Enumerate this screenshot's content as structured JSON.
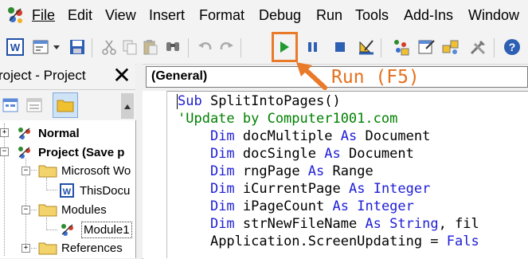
{
  "menu": {
    "items": [
      "File",
      "Edit",
      "View",
      "Insert",
      "Format",
      "Debug",
      "Run",
      "Tools",
      "Add-Ins",
      "Window"
    ]
  },
  "toolbar": {
    "buttons": [
      "word-icon",
      "insert-userform-icon",
      "dropdown-arrow-icon",
      "save-icon",
      "cut-icon",
      "copy-icon",
      "paste-icon",
      "find-icon",
      "undo-icon",
      "redo-icon",
      "run-icon",
      "break-icon",
      "reset-icon",
      "design-mode-icon",
      "project-explorer-icon",
      "properties-window-icon",
      "object-browser-icon",
      "toolbox-icon",
      "help-icon"
    ]
  },
  "project_pane": {
    "title": "roject - Project",
    "close_glyph": "✕",
    "tree": [
      {
        "label": "Normal",
        "bold": true
      },
      {
        "label": "Project (Save p",
        "bold": true
      },
      {
        "label": "Microsoft Wo",
        "bold": false
      },
      {
        "label": "ThisDocu",
        "bold": false
      },
      {
        "label": "Modules",
        "bold": false
      },
      {
        "label": "Module1",
        "bold": false
      },
      {
        "label": "References",
        "bold": false
      }
    ]
  },
  "code_pane": {
    "object_combo": "(General)",
    "lines": [
      {
        "indent": "",
        "parts": [
          {
            "t": "Sub",
            "c": "kw"
          },
          {
            "t": " SplitIntoPages()",
            "c": ""
          }
        ]
      },
      {
        "indent": "",
        "parts": [
          {
            "t": "'Update by Computer1001.com",
            "c": "cm"
          }
        ]
      },
      {
        "indent": "    ",
        "parts": [
          {
            "t": "Dim",
            "c": "kw"
          },
          {
            "t": " docMultiple ",
            "c": ""
          },
          {
            "t": "As",
            "c": "kw"
          },
          {
            "t": " Document",
            "c": ""
          }
        ]
      },
      {
        "indent": "    ",
        "parts": [
          {
            "t": "Dim",
            "c": "kw"
          },
          {
            "t": " docSingle ",
            "c": ""
          },
          {
            "t": "As",
            "c": "kw"
          },
          {
            "t": " Document",
            "c": ""
          }
        ]
      },
      {
        "indent": "    ",
        "parts": [
          {
            "t": "Dim",
            "c": "kw"
          },
          {
            "t": " rngPage ",
            "c": ""
          },
          {
            "t": "As",
            "c": "kw"
          },
          {
            "t": " Range",
            "c": ""
          }
        ]
      },
      {
        "indent": "    ",
        "parts": [
          {
            "t": "Dim",
            "c": "kw"
          },
          {
            "t": " iCurrentPage ",
            "c": ""
          },
          {
            "t": "As",
            "c": "kw"
          },
          {
            "t": " ",
            "c": ""
          },
          {
            "t": "Integer",
            "c": "kw"
          }
        ]
      },
      {
        "indent": "    ",
        "parts": [
          {
            "t": "Dim",
            "c": "kw"
          },
          {
            "t": " iPageCount ",
            "c": ""
          },
          {
            "t": "As",
            "c": "kw"
          },
          {
            "t": " ",
            "c": ""
          },
          {
            "t": "Integer",
            "c": "kw"
          }
        ]
      },
      {
        "indent": "    ",
        "parts": [
          {
            "t": "Dim",
            "c": "kw"
          },
          {
            "t": " strNewFileName ",
            "c": ""
          },
          {
            "t": "As",
            "c": "kw"
          },
          {
            "t": " ",
            "c": ""
          },
          {
            "t": "String",
            "c": "kw"
          },
          {
            "t": ", fil",
            "c": ""
          }
        ]
      },
      {
        "indent": "    ",
        "parts": [
          {
            "t": "Application.ScreenUpdating = ",
            "c": ""
          },
          {
            "t": "Fals",
            "c": "kw"
          }
        ]
      }
    ]
  },
  "annotation": {
    "label": "Run (F5)",
    "color": "#e5711f"
  },
  "colors": {
    "keyword": "#1d1dd6",
    "comment": "#008000",
    "run_green": "#1e9b2e",
    "annotation_orange": "#e87a2a"
  }
}
